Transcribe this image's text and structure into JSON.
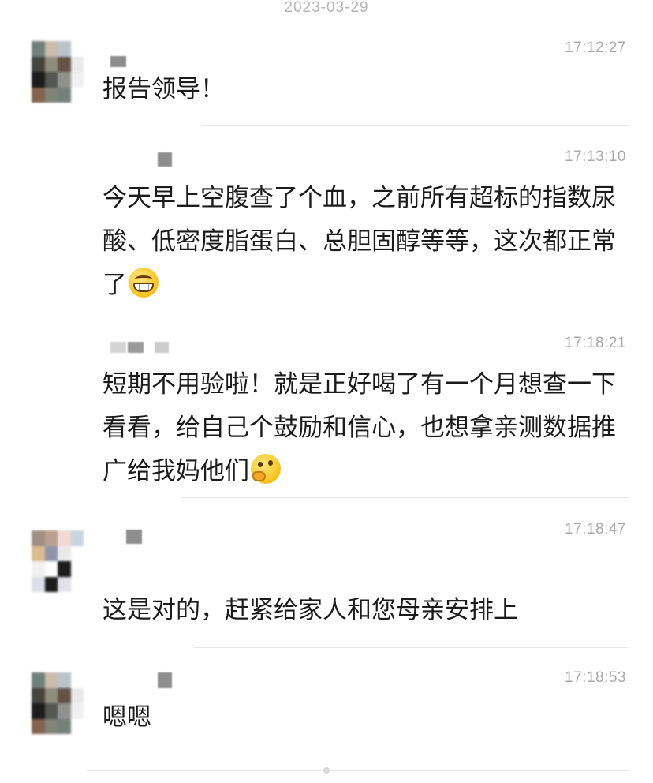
{
  "date": "2023-03-29",
  "messages": [
    {
      "time": "17:12:27",
      "text": "报告领导！"
    },
    {
      "time": "17:13:10",
      "text": "今天早上空腹查了个血，之前所有超标的指数尿酸、低密度脂蛋白、总胆固醇等等，这次都正常了",
      "emoji": "grinning-face-emoji"
    },
    {
      "time": "17:18:21",
      "text": "短期不用验啦！就是正好喝了有一个月想查一下看看，给自己个鼓励和信心，也想拿亲测数据推广给我妈他们",
      "emoji": "thinking-face-emoji"
    },
    {
      "time": "17:18:47",
      "text": "这是对的，赶紧给家人和您母亲安排上"
    },
    {
      "time": "17:18:53",
      "text": "嗯嗯"
    }
  ]
}
